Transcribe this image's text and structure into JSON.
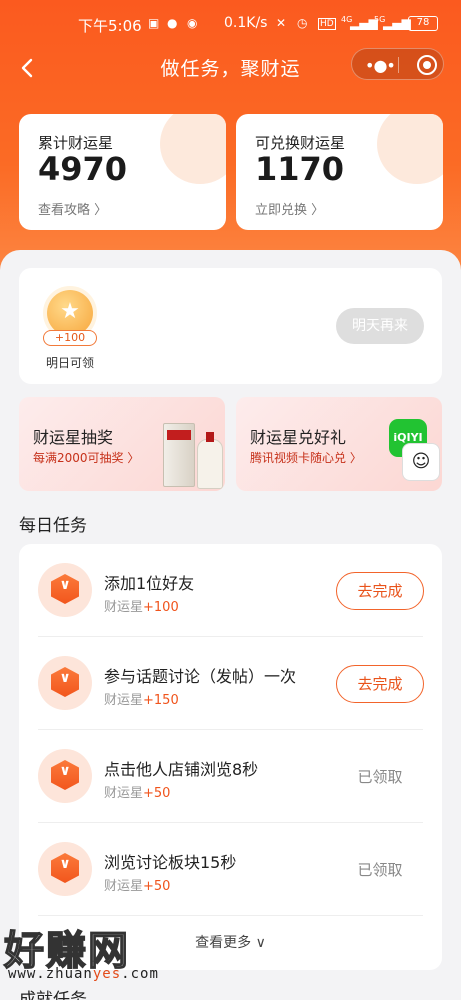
{
  "status_bar": {
    "time": "下午5:06",
    "network_speed": "0.1K/s",
    "battery": "78",
    "signal_labels": [
      "HD",
      "4G",
      "5G"
    ]
  },
  "nav": {
    "title": "做任务，聚财运",
    "back_icon": "chevron-left-icon",
    "more_icon": "more-dots-icon",
    "close_icon": "target-circle-icon"
  },
  "stats": [
    {
      "label": "累计财运星",
      "value": "4970",
      "link": "查看攻略 〉"
    },
    {
      "label": "可兑换财运星",
      "value": "1170",
      "link": "立即兑换 〉"
    }
  ],
  "checkin": {
    "coin_bonus": "+100",
    "coin_label": "明日可领",
    "button": "明天再来"
  },
  "promos": [
    {
      "title": "财运星抽奖",
      "subtitle": "每满2000可抽奖 〉"
    },
    {
      "title": "财运星兑好礼",
      "subtitle": "腾讯视频卡随心兑 〉",
      "logo": "iQIYI"
    }
  ],
  "daily_tasks": {
    "title": "每日任务",
    "reward_prefix": "财运星",
    "items": [
      {
        "name": "添加1位好友",
        "reward": "+100",
        "action": "去完成",
        "done": false
      },
      {
        "name": "参与话题讨论（发帖）一次",
        "reward": "+150",
        "action": "去完成",
        "done": false
      },
      {
        "name": "点击他人店铺浏览8秒",
        "reward": "+50",
        "action": "已领取",
        "done": true
      },
      {
        "name": "浏览讨论板块15秒",
        "reward": "+50",
        "action": "已领取",
        "done": true
      }
    ],
    "more": "查看更多 ∨"
  },
  "achievement_tasks": {
    "title": "成就任务"
  },
  "watermark": {
    "brand": "好赚网",
    "url_pre": "www.zhuan",
    "url_hl": "yes",
    "url_post": ".com"
  },
  "colors": {
    "accent": "#f2561d",
    "hero_top": "#fb5a1f",
    "hero_bottom": "#fc8c49",
    "panel_bg": "#f3f3f5"
  }
}
